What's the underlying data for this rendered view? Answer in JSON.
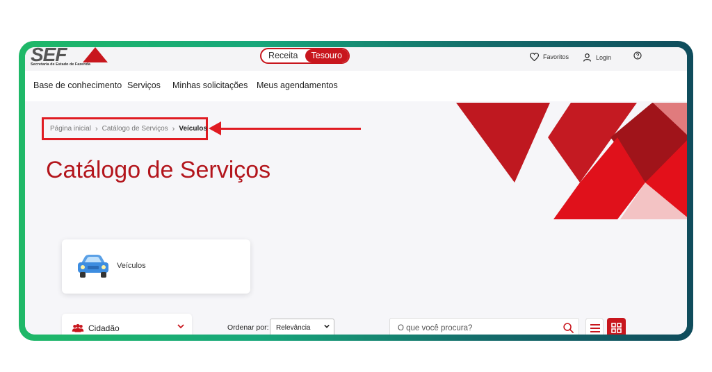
{
  "logo": {
    "text": "SEF",
    "subtitle": "Secretaria de Estado de Fazenda"
  },
  "toggle": {
    "options": [
      {
        "label": "Receita",
        "active": false
      },
      {
        "label": "Tesouro",
        "active": true
      }
    ]
  },
  "top_links": {
    "favorites": "Favoritos",
    "login": "Login"
  },
  "nav": {
    "items": [
      {
        "label": "Base de conhecimento"
      },
      {
        "label": "Serviços"
      },
      {
        "label": "Minhas solicitações"
      },
      {
        "label": "Meus agendamentos"
      }
    ]
  },
  "breadcrumb": {
    "items": [
      {
        "label": "Página inicial"
      },
      {
        "label": "Catálogo de Serviços"
      },
      {
        "label": "Veículos"
      }
    ]
  },
  "page_title": "Catálogo de Serviços",
  "card": {
    "label": "Veículos"
  },
  "filter": {
    "label": "Cidadão"
  },
  "sort": {
    "label": "Ordenar por:",
    "selected": "Relevância"
  },
  "search": {
    "placeholder": "O que você procura?"
  },
  "colors": {
    "brand_red": "#c8161d",
    "accent_red": "#e01b22",
    "frame_green": "#1fb868",
    "frame_teal": "#0f4c5c"
  },
  "icons": {
    "favorites": "heart-icon",
    "login": "user-icon",
    "help": "question-circle-icon",
    "filter": "users-icon",
    "search": "search-icon",
    "list_view": "list-icon",
    "grid_view": "grid-icon",
    "card": "car-icon"
  }
}
